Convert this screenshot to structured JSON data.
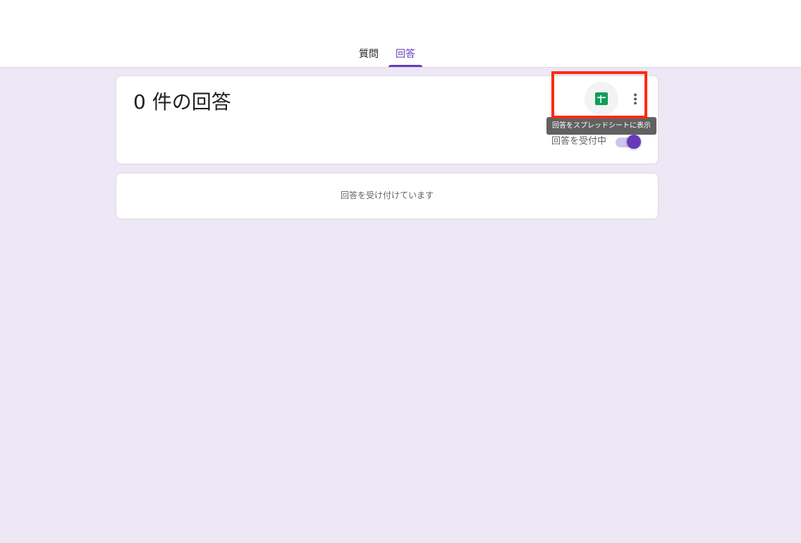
{
  "tabs": [
    {
      "label": "質問",
      "selected": false
    },
    {
      "label": "回答",
      "selected": true
    }
  ],
  "summary": {
    "count_title": "0 件の回答",
    "sheets_icon": "google-sheets-icon",
    "more_icon": "more-vert-icon",
    "accepting_label": "回答を受付中",
    "accepting_enabled": true
  },
  "tooltip": {
    "text": "回答をスプレッドシートに表示"
  },
  "status": {
    "text": "回答を受け付けています"
  },
  "colors": {
    "accent": "#673ab7",
    "accent_light": "#d1c4e9",
    "background": "#ede7f6",
    "sheets_green": "#0f9d58",
    "annotation_red": "#ff2a12",
    "tooltip_bg": "#616161"
  }
}
